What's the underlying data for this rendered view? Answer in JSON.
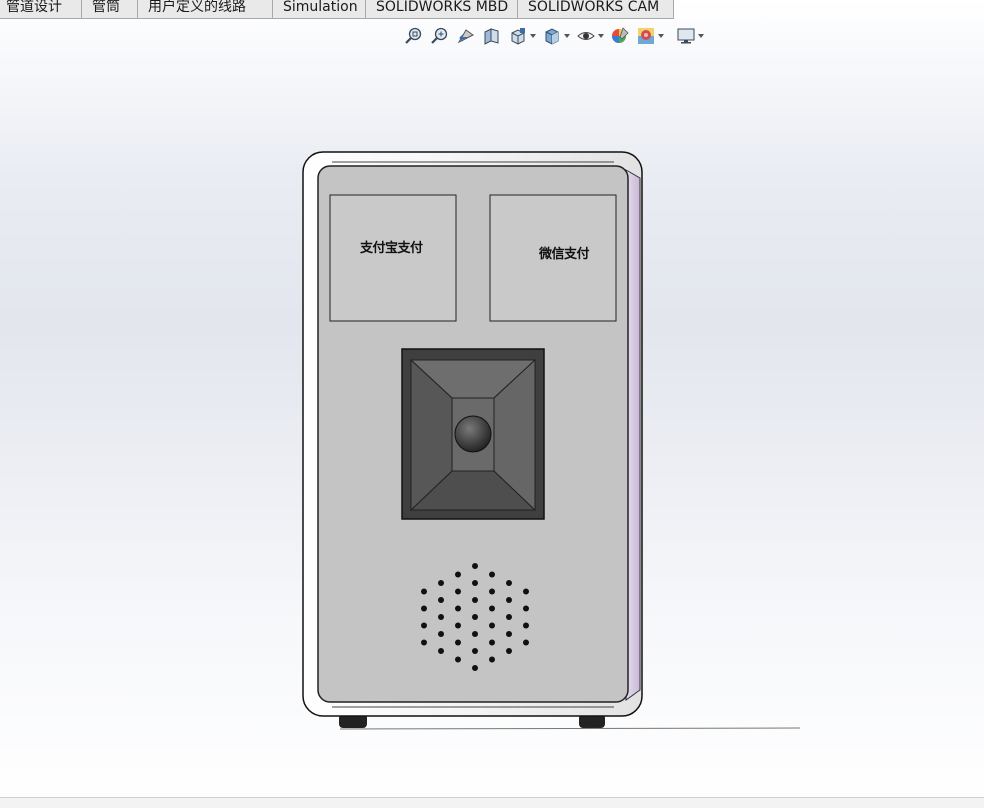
{
  "tabs": [
    "管道设计",
    "管筒",
    "用户定义的线路",
    "Simulation",
    "SOLIDWORKS MBD",
    "SOLIDWORKS CAM"
  ],
  "view_toolbar": {
    "icons": [
      "zoom-to-fit-icon",
      "zoom-to-area-icon",
      "previous-view-icon",
      "section-view-icon",
      "view-orientation-icon",
      "display-style-icon",
      "hide-show-items-icon",
      "edit-appearance-icon",
      "apply-scene-icon",
      "view-settings-icon"
    ]
  },
  "model": {
    "panel_left_label": "支付宝支付",
    "panel_right_label": "微信支付"
  },
  "colors": {
    "body_face": "#c4c4c4",
    "frame": "#f2f2f2",
    "side_accent": "#d8c9e0",
    "scanner_dark": "#4a4a4a"
  }
}
